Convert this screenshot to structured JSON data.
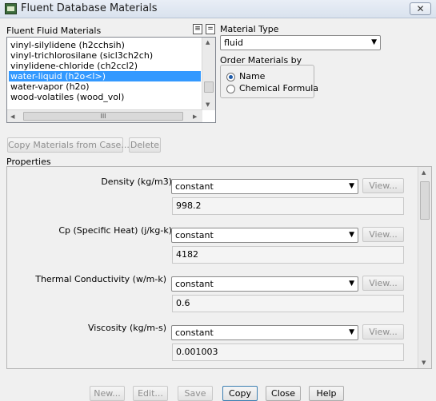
{
  "window": {
    "title": "Fluent Database Materials",
    "close_label": "✕"
  },
  "materials_list": {
    "label": "Fluent Fluid Materials",
    "items": [
      "vinyl-silylidene (h2cchsih)",
      "vinyl-trichlorosilane (sicl3ch2ch)",
      "vinylidene-chloride (ch2ccl2)",
      "water-liquid (h2o<l>)",
      "water-vapor (h2o)",
      "wood-volatiles (wood_vol)"
    ],
    "selected_index": 3,
    "list_icon_a": "list-all-icon",
    "list_icon_b": "list-clear-icon",
    "hscroll_grip": "III"
  },
  "material_type": {
    "label": "Material Type",
    "value": "fluid"
  },
  "order_by": {
    "label": "Order Materials by",
    "options": [
      "Name",
      "Chemical Formula"
    ],
    "selected": "Name"
  },
  "actions": {
    "copy_from_case": "Copy Materials from Case...",
    "delete": "Delete"
  },
  "properties": {
    "title": "Properties",
    "items": [
      {
        "label": "Density (kg/m3)",
        "method": "constant",
        "view": "View...",
        "value": "998.2"
      },
      {
        "label": "Cp (Specific Heat) (j/kg-k)",
        "method": "constant",
        "view": "View...",
        "value": "4182"
      },
      {
        "label": "Thermal Conductivity (w/m-k)",
        "method": "constant",
        "view": "View...",
        "value": "0.6"
      },
      {
        "label": "Viscosity (kg/m-s)",
        "method": "constant",
        "view": "View...",
        "value": "0.001003"
      }
    ]
  },
  "footer": {
    "new": "New...",
    "edit": "Edit...",
    "save": "Save",
    "copy": "Copy",
    "close": "Close",
    "help": "Help"
  }
}
